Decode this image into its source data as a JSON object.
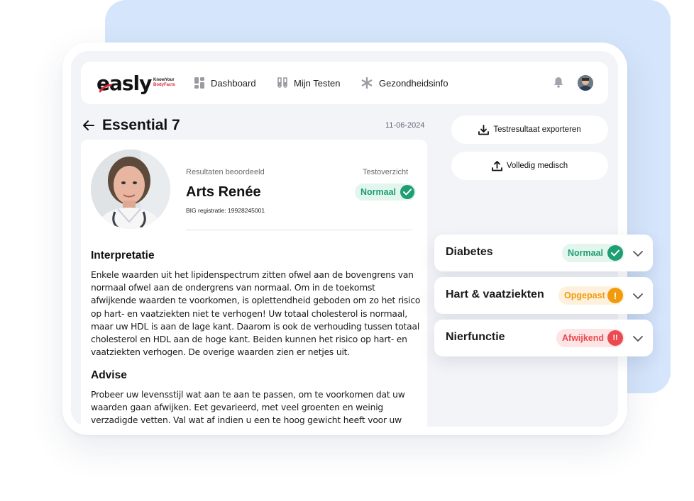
{
  "app": {
    "logo_text": "easly",
    "logo_tagline_1": "KnowYour",
    "logo_tagline_2": "BodyFacts"
  },
  "nav": {
    "items": [
      {
        "label": "Dashboard",
        "icon": "dashboard-icon"
      },
      {
        "label": "Mijn Testen",
        "icon": "test-tubes-icon"
      },
      {
        "label": "Gezondheidsinfo",
        "icon": "asterisk-icon"
      }
    ],
    "notifications_icon": "bell-icon",
    "avatar": "user-avatar"
  },
  "page": {
    "title": "Essential 7",
    "date": "11-06-2024"
  },
  "doctor": {
    "results_label": "Resultaten beoordeeld",
    "name": "Arts Renée",
    "big_registration": "BIG registratie: 19928245001",
    "overview_label": "Testoverzicht",
    "overview_status": "Normaal"
  },
  "interpretation": {
    "title": "Interpretatie",
    "lines": [
      "Enkele waarden uit het lipidenspectrum zitten ofwel aan de bovengrens van",
      "normaal ofwel aan de ondergrens van normaal. Om in de toekomst",
      "afwijkende waarden te voorkomen, is oplettendheid geboden om zo het risico",
      "op hart- en vaatziekten niet te verhogen! Uw totaal cholesterol is normaal,",
      "maar uw HDL is aan de lage kant. Daarom is ook de verhouding tussen totaal",
      "cholesterol en HDL aan de hoge kant. Beiden kunnen het risico op hart- en",
      "vaatziekten verhogen. De overige waarden zien er netjes uit."
    ]
  },
  "advice": {
    "title": "Advise",
    "lines": [
      "Probeer uw levensstijl wat aan te aan te passen, om te voorkomen dat uw",
      "waarden gaan afwijken. Eet gevarieerd, met veel groenten en weinig",
      "verzadigde vetten. Val wat af indien u een te hoog gewicht heeft voor uw"
    ]
  },
  "actions": {
    "export_label": "Testresultaat exporteren",
    "full_medical_label": "Volledig medisch"
  },
  "results": [
    {
      "label": "Diabetes",
      "status": "Normaal",
      "status_color": "#1f9d74",
      "bg": "#e2f6ee",
      "icon": "check-icon"
    },
    {
      "label": "Hart & vaatziekten",
      "status": "Opgepast",
      "status_color": "#f29a0d",
      "bg": "#fdf1dd",
      "icon": "exclamation-icon",
      "symbol": "!"
    },
    {
      "label": "Nierfunctie",
      "status": "Afwijkend",
      "status_color": "#ea4a50",
      "bg": "#fde5e6",
      "icon": "double-exclamation-icon",
      "symbol": "!!"
    }
  ]
}
